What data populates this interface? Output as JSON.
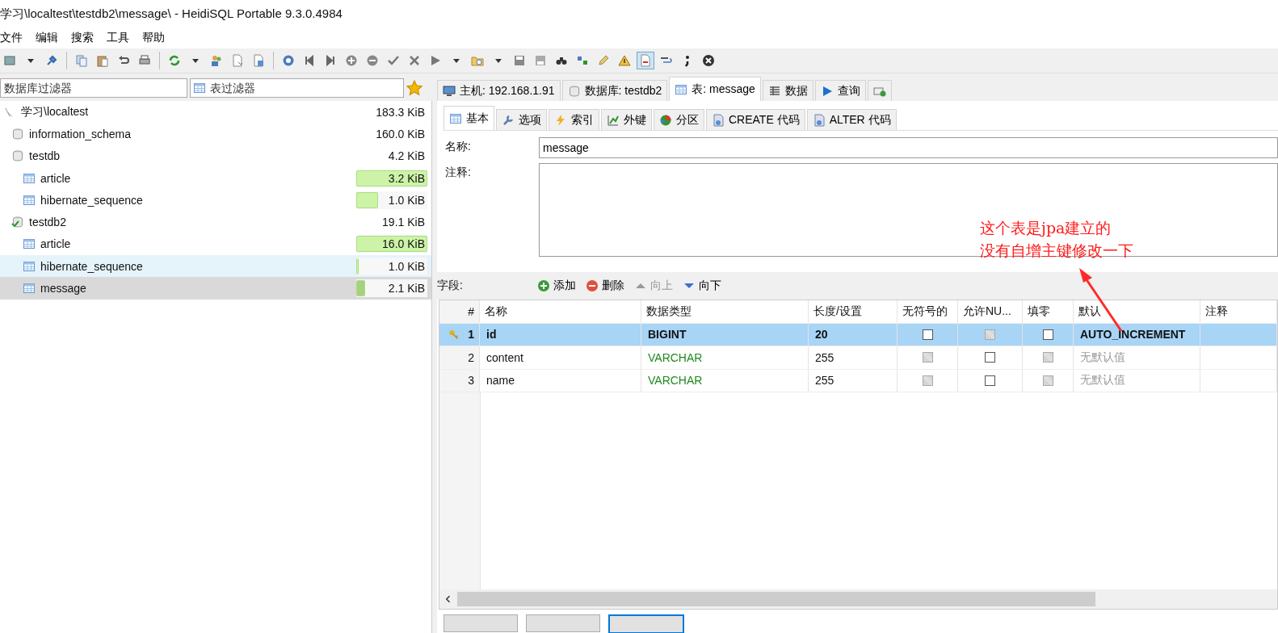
{
  "window": {
    "title": "学习\\localtest\\testdb2\\message\\ - HeidiSQL Portable 9.3.0.4984"
  },
  "menu": [
    "文件",
    "编辑",
    "搜索",
    "工具",
    "帮助"
  ],
  "filters": {
    "database_placeholder": "数据库过滤器",
    "table_placeholder": "表过滤器"
  },
  "tree": {
    "label": "学习\\localtest",
    "size": "183.3 KiB",
    "children": [
      {
        "label": "information_schema",
        "size": "160.0 KiB",
        "active": false
      },
      {
        "label": "testdb",
        "size": "4.2 KiB",
        "active": false,
        "children": [
          {
            "label": "article",
            "size": "3.2 KiB",
            "level": 1.0,
            "selected": false,
            "hovered": false
          },
          {
            "label": "hibernate_sequence",
            "size": "1.0 KiB",
            "level": 0.31,
            "selected": false,
            "hovered": false
          }
        ]
      },
      {
        "label": "testdb2",
        "size": "19.1 KiB",
        "active": true,
        "children": [
          {
            "label": "article",
            "size": "16.0 KiB",
            "level": 1.0,
            "selected": false,
            "hovered": false
          },
          {
            "label": "hibernate_sequence",
            "size": "1.0 KiB",
            "level": 0.03,
            "selected": false,
            "hovered": true
          },
          {
            "label": "message",
            "size": "2.1 KiB",
            "level": 0.13,
            "selected": true,
            "hovered": false
          }
        ]
      }
    ]
  },
  "tabs": [
    {
      "label": "主机: 192.168.1.91",
      "kind": "host",
      "selected": false
    },
    {
      "label": "数据库: testdb2",
      "kind": "database",
      "selected": false
    },
    {
      "label": "表: message",
      "kind": "table",
      "selected": true
    },
    {
      "label": "数据",
      "kind": "data",
      "selected": false
    },
    {
      "label": "查询",
      "kind": "query",
      "selected": false
    }
  ],
  "subtabs": [
    {
      "label": "基本",
      "kind": "basic",
      "selected": true
    },
    {
      "label": "选项",
      "kind": "options",
      "selected": false
    },
    {
      "label": "索引",
      "kind": "index",
      "selected": false
    },
    {
      "label": "外键",
      "kind": "foreign",
      "selected": false
    },
    {
      "label": "分区",
      "kind": "partition",
      "selected": false
    },
    {
      "label": "CREATE 代码",
      "kind": "code",
      "selected": false
    },
    {
      "label": "ALTER 代码",
      "kind": "code",
      "selected": false
    }
  ],
  "form": {
    "name_label": "名称:",
    "name_value": "message",
    "comment_label": "注释:"
  },
  "fields": {
    "label": "字段:",
    "actions": [
      {
        "label": "添加",
        "kind": "add",
        "disabled": false
      },
      {
        "label": "删除",
        "kind": "delete",
        "disabled": false
      },
      {
        "label": "向上",
        "kind": "up",
        "disabled": true
      },
      {
        "label": "向下",
        "kind": "down",
        "disabled": false
      }
    ]
  },
  "grid": {
    "columns": [
      "#",
      "名称",
      "数据类型",
      "长度/设置",
      "无符号的",
      "允许NU...",
      "填零",
      "默认",
      "注释"
    ],
    "rows": [
      {
        "num": "1",
        "primary_key": true,
        "selected": true,
        "name": "id",
        "type": "BIGINT",
        "length": "20",
        "unsigned": {
          "checked": false,
          "disabled": false
        },
        "allow_null": {
          "checked": false,
          "disabled": true
        },
        "zerofill": {
          "checked": false,
          "disabled": false
        },
        "default": "AUTO_INCREMENT",
        "default_muted": false
      },
      {
        "num": "2",
        "primary_key": false,
        "selected": false,
        "name": "content",
        "type": "VARCHAR",
        "color": "#1e8a1e",
        "length": "255",
        "unsigned": {
          "checked": false,
          "disabled": true
        },
        "allow_null": {
          "checked": false,
          "disabled": false
        },
        "zerofill": {
          "checked": false,
          "disabled": true
        },
        "default": "无默认值",
        "default_muted": true
      },
      {
        "num": "3",
        "primary_key": false,
        "selected": false,
        "name": "name",
        "type": "VARCHAR",
        "color": "#1e8a1e",
        "length": "255",
        "unsigned": {
          "checked": false,
          "disabled": true
        },
        "allow_null": {
          "checked": false,
          "disabled": false
        },
        "zerofill": {
          "checked": false,
          "disabled": true
        },
        "default": "无默认值",
        "default_muted": true
      }
    ]
  },
  "annotation": {
    "lines": [
      "这个表是jpa建立的",
      "没有自增主键修改一下"
    ]
  }
}
